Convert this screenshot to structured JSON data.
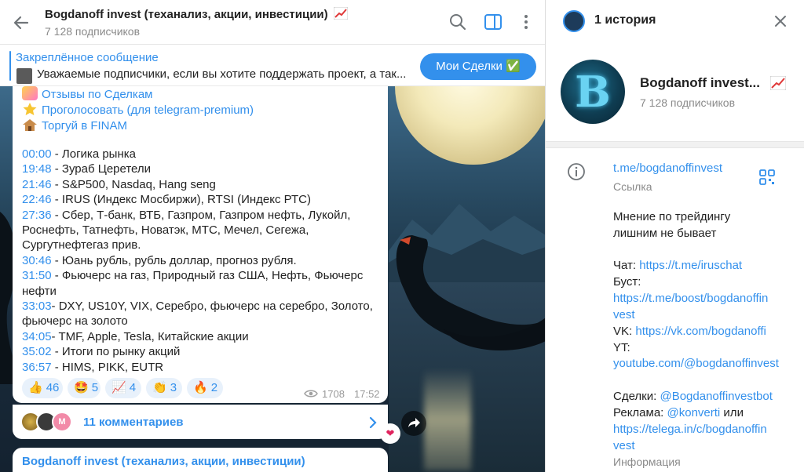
{
  "chat": {
    "title": "Bogdanoff invest (теханализ, акции, инвестиции)",
    "subscribers": "7 128 подписчиков"
  },
  "pinned": {
    "title": "Закреплённое сообщение",
    "text": "Уважаемые подписчики, если вы хотите поддержать проект, а так...",
    "button": "Мои Сделки ✅"
  },
  "message": {
    "links": [
      "Отзывы по Сделкам",
      "Проголосовать (для telegram-premium)",
      "Торгуй в FINAM"
    ],
    "timecodes": [
      {
        "t": "00:00",
        "sep": " - ",
        "text": "Логика рынка"
      },
      {
        "t": "19:48",
        "sep": " - ",
        "text": "Зураб Церетели"
      },
      {
        "t": "21:46",
        "sep": " - ",
        "text": "S&P500, Nasdaq, Hang seng"
      },
      {
        "t": "22:46",
        "sep": " - ",
        "text": "IRUS (Индекс Мосбиржи), RTSI (Индекс РТС)"
      },
      {
        "t": "27:36",
        "sep": " - ",
        "text": "Сбер, Т-банк, ВТБ, Газпром, Газпром нефть, Лукойл,"
      },
      {
        "t": "",
        "sep": "",
        "text": "Роснефть, Татнефть, Новатэк, МТС, Мечел, Сегежа,"
      },
      {
        "t": "",
        "sep": "",
        "text": "Сургутнефтегаз прив."
      },
      {
        "t": "30:46",
        "sep": " - ",
        "text": "Юань рубль, рубль доллар, прогноз рубля."
      },
      {
        "t": "31:50",
        "sep": " - ",
        "text": "Фьючерс на газ, Природный газ США, Нефть, Фьючерс"
      },
      {
        "t": "",
        "sep": "",
        "text": "нефти"
      },
      {
        "t": "33:03",
        "sep": "- ",
        "text": "DXY, US10Y, VIX, Серебро, фьючерс на серебро, Золото,"
      },
      {
        "t": "",
        "sep": "",
        "text": "фьючерс на золото"
      },
      {
        "t": "34:05",
        "sep": "- ",
        "text": "TMF, Apple, Tesla, Китайские акции"
      },
      {
        "t": "35:02",
        "sep": " - ",
        "text": "Итоги по рынку акций"
      },
      {
        "t": "36:57",
        "sep": " - ",
        "text": "HIMS, PIKK, EUTR"
      }
    ],
    "reactions": [
      {
        "emoji": "👍",
        "count": "46"
      },
      {
        "emoji": "🤩",
        "count": "5"
      },
      {
        "emoji": "📈",
        "count": "4"
      },
      {
        "emoji": "👏",
        "count": "3"
      },
      {
        "emoji": "🔥",
        "count": "2"
      }
    ],
    "views": "1708",
    "time": "17:52",
    "comments": "11 комментариев",
    "avatar_letter": "M"
  },
  "next_message": {
    "title": "Bogdanoff invest (теханализ, акции, инвестиции)"
  },
  "panel": {
    "story_title": "1 история",
    "name": "Bogdanoff invest...",
    "subscribers": "7 128 подписчиков",
    "avatar_letter": "B",
    "link": "t.me/bogdanoffinvest",
    "link_label": "Ссылка",
    "description": [
      "Мнение по трейдингу",
      "лишним не бывает"
    ],
    "lines": [
      {
        "label": "Чат: ",
        "value": "https://t.me/iruschat"
      },
      {
        "label": "Буст:",
        "value": ""
      },
      {
        "label": "",
        "value": "https://t.me/boost/bogdanoffin"
      },
      {
        "label": "",
        "value": "vest"
      },
      {
        "label": "VK: ",
        "value": "https://vk.com/bogdanoffi"
      },
      {
        "label": "YT:",
        "value": ""
      },
      {
        "label": "",
        "value": "youtube.com/@bogdanoffinvest"
      },
      {
        "label": "",
        "value": ""
      },
      {
        "label": "Сделки: ",
        "value": "@Bogdanoffinvestbot"
      },
      {
        "label": "Реклама: ",
        "value": "@konverti",
        "suffix": " или"
      },
      {
        "label": "",
        "value": "https://telega.in/c/bogdanoffin"
      },
      {
        "label": "",
        "value": "vest"
      }
    ],
    "info_label": "Информация"
  },
  "colors": {
    "accent": "#3390ec",
    "reaction_bg": "#e8f1fb",
    "muted": "#8a8a8a"
  },
  "icons": {
    "header": [
      "back-arrow-icon",
      "search-icon",
      "sidebar-toggle-icon",
      "more-vertical-icon"
    ],
    "panel": [
      "close-icon",
      "info-icon",
      "qr-code-icon"
    ]
  }
}
